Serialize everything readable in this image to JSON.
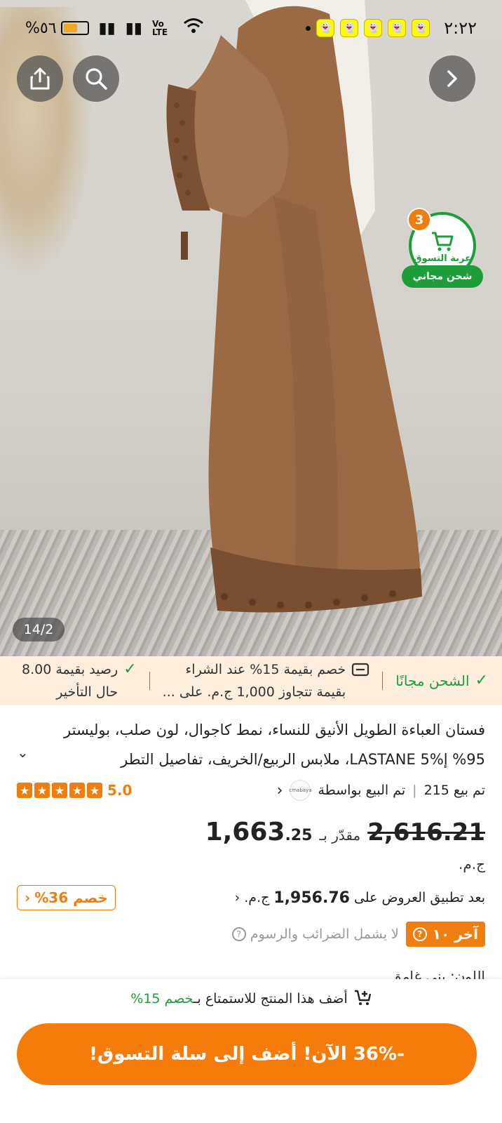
{
  "status_bar": {
    "time": "٢:٢٢",
    "battery": "%٥٦",
    "volte": "Vo LTE",
    "notification_count": 5
  },
  "gallery": {
    "counter": "14/2"
  },
  "cart": {
    "count": "3",
    "label": "عربة التسوق",
    "shipping_label": "شحن مجاني"
  },
  "promos": {
    "free_shipping": "الشحن مجانًا",
    "discount_line1": "خصم بقيمة 15% عند الشراء",
    "discount_line2": "بقيمة تتجاوز 1,000 ج.م. على ...",
    "credit_line1": "رصيد بقيمة 8.00",
    "credit_line2": "حال التأخير"
  },
  "product": {
    "title": "فستان العباءة الطويل الأنيق للنساء، نمط كاجوال، لون صلب، بوليستر 95% إ%5 LASTANE، ملابس الربيع/الخريف، تفاصيل التطر",
    "sold": "تم بيع 215",
    "sold_by": "تم البيع بواسطة",
    "seller_logo": "cmabaya",
    "rating": "5.0",
    "stars": 5
  },
  "pricing": {
    "original_price": "2,616.21",
    "estimated_label": "مقدّر بـ",
    "sale_price_main": "1,663",
    "sale_price_decimal": ".25",
    "currency": "ج.م.",
    "after_offers_label": "بعد تطبيق العروض على",
    "after_offers_price": "1,956.76",
    "after_offers_currency": "ج.م.",
    "discount_chip": "خصم 36%",
    "last_badge": "آخر ١٠",
    "tax_note": "لا يشمل الضرائب والرسوم"
  },
  "variant": {
    "color_line": "اللون: بني غامق"
  },
  "bottom": {
    "promo_prefix": "أضف هذا المنتج للاستمتاع بـ",
    "promo_highlight": "خصم 15%",
    "cta_label": "-36% الآن! أضف إلى سلة التسوق!"
  },
  "colors": {
    "accent_orange": "#f57c0b",
    "green": "#1e9e3a",
    "promo_bg": "#fdeede"
  }
}
